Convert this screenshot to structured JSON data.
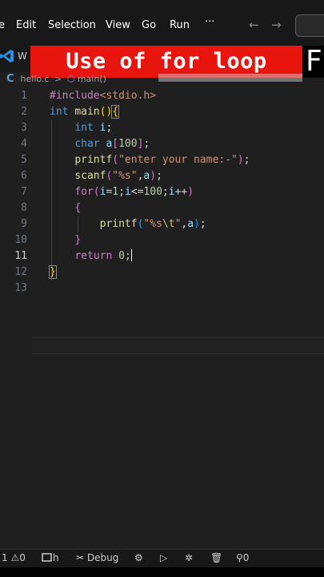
{
  "menu": {
    "items": [
      {
        "label": "e"
      },
      {
        "label": "Edit"
      },
      {
        "label": "Selection"
      },
      {
        "label": "View"
      },
      {
        "label": "Go"
      },
      {
        "label": "Run"
      }
    ],
    "more": "···",
    "back": "←",
    "forward": "→"
  },
  "tab": {
    "partial_label": "W"
  },
  "banner": {
    "text": "Use of for loop",
    "trailing_letter": "F"
  },
  "breadcrumb": {
    "file": "hello.c",
    "separator": ">",
    "symbol": "main()"
  },
  "editor": {
    "active_line": 11,
    "lines": [
      {
        "num": "1"
      },
      {
        "num": "2"
      },
      {
        "num": "3"
      },
      {
        "num": "4"
      },
      {
        "num": "5"
      },
      {
        "num": "6"
      },
      {
        "num": "7"
      },
      {
        "num": "8"
      },
      {
        "num": "9"
      },
      {
        "num": "10"
      },
      {
        "num": "11"
      },
      {
        "num": "12"
      },
      {
        "num": "13"
      }
    ],
    "code": {
      "l1_pre": "#include",
      "l1_hdr": "<stdio.h>",
      "l2_type": "int",
      "l2_fn": "main",
      "l3_type": "int",
      "l3_var": "i",
      "l4_type": "char",
      "l4_var": "a",
      "l4_num": "100",
      "l5_fn": "printf",
      "l5_str": "\"enter your name:-\"",
      "l6_fn": "scanf",
      "l6_str": "\"%s\"",
      "l6_var": "a",
      "l7_kw": "for",
      "l7_var1": "i",
      "l7_num1": "1",
      "l7_var2": "i",
      "l7_num2": "100",
      "l7_var3": "i",
      "l9_fn": "printf",
      "l9_str1": "\"%s",
      "l9_esc": "\\t",
      "l9_str2": "\"",
      "l9_var": "a",
      "l11_kw": "return",
      "l11_num": "0"
    }
  },
  "statusbar": {
    "errors": "1",
    "warnings": "0",
    "debug_label": "Debug",
    "ports": "0",
    "h_label": "h"
  },
  "colors": {
    "banner_bg": "#e8140e",
    "editor_bg": "#1f1f1f",
    "keyword": "#569cd6",
    "function": "#dcdcaa",
    "string": "#ce9178"
  },
  "icons": [
    "vscode-icon",
    "c-file-icon",
    "method-icon",
    "error-icon",
    "warning-icon",
    "run-debug-icon",
    "settings-icon",
    "play-icon",
    "debug-gear-icon",
    "trash-icon",
    "broadcast-icon"
  ]
}
